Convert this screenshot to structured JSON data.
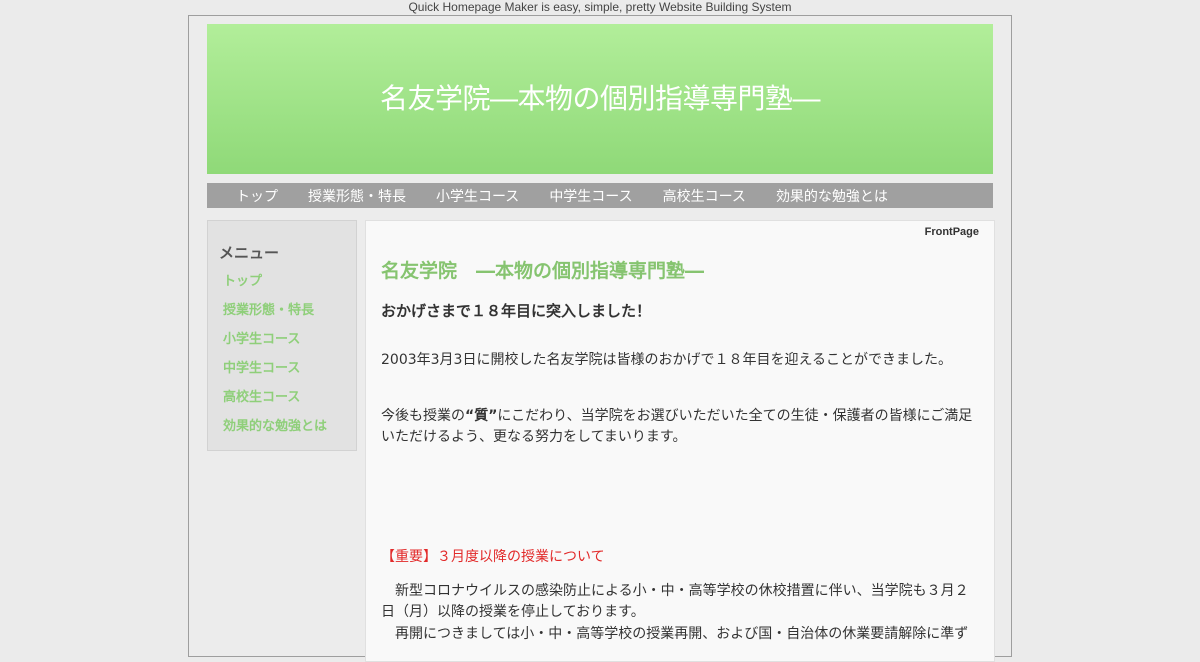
{
  "tagline": "Quick Homepage Maker is easy, simple, pretty Website Building System",
  "site": {
    "title": "名友学院―本物の個別指導専門塾―"
  },
  "nav": {
    "items": [
      "トップ",
      "授業形態・特長",
      "小学生コース",
      "中学生コース",
      "高校生コース",
      "効果的な勉強とは"
    ]
  },
  "sidebar": {
    "title": "メニュー",
    "items": [
      "トップ",
      "授業形態・特長",
      "小学生コース",
      "中学生コース",
      "高校生コース",
      "効果的な勉強とは"
    ]
  },
  "main": {
    "page_label": "FrontPage",
    "heading": "名友学院　―本物の個別指導専門塾―",
    "subheading": "おかげさまで１８年目に突入しました！",
    "para1": "2003年3月3日に開校した名友学院は皆様のおかげで１８年目を迎えることができました。",
    "para2_before": "今後も授業の",
    "para2_bold": "“質”",
    "para2_after": "にこだわり、当学院をお選びいただいた全ての生徒・保護者の皆様にご満足いただけるよう、更なる努力をしてまいります。",
    "important": "【重要】３月度以降の授業について",
    "para3": "　新型コロナウイルスの感染防止による小・中・高等学校の休校措置に伴い、当学院も３月２日（月）以降の授業を停止しております。",
    "para4": "　再開につきましては小・中・高等学校の授業再開、および国・自治体の休業要請解除に準ず"
  },
  "colors": {
    "header_gradient_top": "#b2ee9a",
    "header_gradient_bottom": "#8fd978",
    "nav_bg": "#a0a0a0",
    "accent_green": "#86c470",
    "important_red": "#e22a2a"
  }
}
